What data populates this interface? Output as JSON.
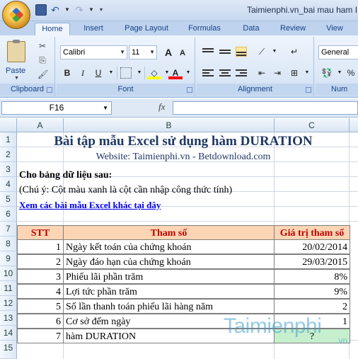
{
  "window": {
    "title": "Taimienphi.vn_bai mau ham I"
  },
  "ribbon": {
    "tabs": [
      {
        "label": "Home"
      },
      {
        "label": "Insert"
      },
      {
        "label": "Page Layout"
      },
      {
        "label": "Formulas"
      },
      {
        "label": "Data"
      },
      {
        "label": "Review"
      },
      {
        "label": "View"
      }
    ],
    "clipboard": {
      "paste_label": "Paste",
      "group_label": "Clipboard"
    },
    "font": {
      "font_name": "Calibri",
      "font_size": "11",
      "group_label": "Font",
      "bold": "B",
      "italic": "I",
      "underline": "U",
      "grow": "A",
      "shrink": "A",
      "font_color": "A"
    },
    "alignment": {
      "group_label": "Alignment"
    },
    "number": {
      "format": "General",
      "group_label": "Num",
      "percent": "%"
    }
  },
  "formula_bar": {
    "name_box": "F16",
    "fx": "fx",
    "formula": ""
  },
  "columns": [
    "A",
    "B",
    "C"
  ],
  "rows": [
    "1",
    "2",
    "3",
    "4",
    "5",
    "6",
    "7",
    "8",
    "9",
    "10",
    "11",
    "12",
    "13",
    "14",
    "15"
  ],
  "sheet": {
    "title": "Bài tập mẫu Excel sử dụng hàm DURATION",
    "website": "Website: Taimienphi.vn - Betdownload.com",
    "prompt": "Cho bảng dữ liệu sau:",
    "note": "(Chú ý: Cột màu xanh là cột cần nhập công thức tính)",
    "link": "Xem các bài mẫu Excel khác tại đây",
    "table": {
      "headers": [
        "STT",
        "Tham số",
        "Giá trị tham số"
      ],
      "rows": [
        {
          "stt": "1",
          "param": "Ngày kết toán của chứng khoán",
          "value": "20/02/2014"
        },
        {
          "stt": "2",
          "param": "Ngày đáo hạn của chứng khoán",
          "value": "29/03/2015"
        },
        {
          "stt": "3",
          "param": "Phiếu lãi phần trăm",
          "value": "8%"
        },
        {
          "stt": "4",
          "param": "Lợi tức phần trăm",
          "value": "9%"
        },
        {
          "stt": "5",
          "param": "Số lần thanh toán phiếu lãi hàng năm",
          "value": "2"
        },
        {
          "stt": "6",
          "param": "Cơ sở đếm ngày",
          "value": "1"
        },
        {
          "stt": "7",
          "param": "hàm DURATION",
          "value": "?"
        }
      ]
    }
  },
  "watermark": {
    "text": "Taimienphi",
    "suffix": ".vn"
  },
  "colors": {
    "header_fill": "#fcd5b4",
    "header_text": "#c00000",
    "result_fill": "#c6efce",
    "title_text": "#1f3864"
  }
}
